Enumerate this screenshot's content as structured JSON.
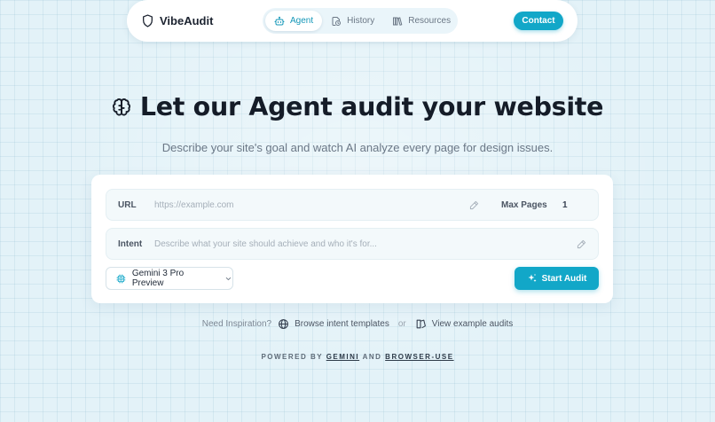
{
  "brand": {
    "name": "VibeAudit"
  },
  "nav": {
    "tabs": [
      {
        "label": "Agent",
        "icon": "robot-icon",
        "active": true
      },
      {
        "label": "History",
        "icon": "clock-document-icon",
        "active": false
      },
      {
        "label": "Resources",
        "icon": "books-icon",
        "active": false
      }
    ],
    "contact_label": "Contact"
  },
  "hero": {
    "title": "Let our Agent audit your website",
    "subtitle": "Describe your site's goal and watch AI analyze every page for design issues."
  },
  "form": {
    "url_label": "URL",
    "url_placeholder": "https://example.com",
    "max_pages_label": "Max Pages",
    "max_pages_value": "1",
    "intent_label": "Intent",
    "intent_placeholder": "Describe what your site should achieve and who it's for...",
    "model_selected": "Gemini 3 Pro Preview",
    "start_label": "Start Audit"
  },
  "inspiration": {
    "prompt": "Need Inspiration?",
    "browse_label": "Browse intent templates",
    "or": "or",
    "examples_label": "View example audits"
  },
  "footer": {
    "powered_prefix": "POWERED BY",
    "gemini": "GEMINI",
    "and": "AND",
    "browser_use": "BROWSER-USE"
  },
  "colors": {
    "accent": "#12a7c8",
    "background": "#e3f2f8",
    "title": "#151c28"
  }
}
